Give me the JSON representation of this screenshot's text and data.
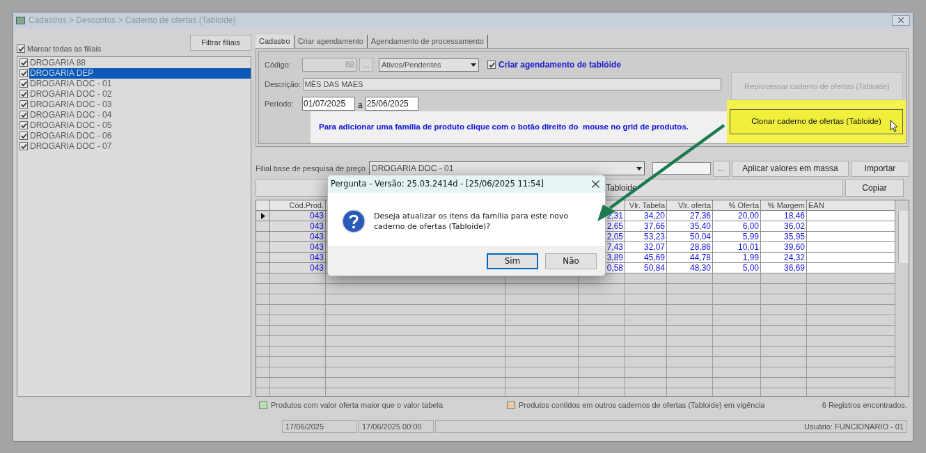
{
  "window": {
    "title": "Cadastros > Descontos > Caderno de ofertas (Tabloide)"
  },
  "branches": {
    "filter_button": "Filtrar filiais",
    "select_all": {
      "label": "Marcar todas as filiais",
      "checked": true
    },
    "items": [
      {
        "label": "DROGARIA 88",
        "checked": true,
        "selected": false
      },
      {
        "label": "DROGARIA DEP",
        "checked": true,
        "selected": true
      },
      {
        "label": "DROGARIA DOC - 01",
        "checked": true,
        "selected": false
      },
      {
        "label": "DROGARIA DOC - 02",
        "checked": true,
        "selected": false
      },
      {
        "label": "DROGARIA DOC - 03",
        "checked": true,
        "selected": false
      },
      {
        "label": "DROGARIA DOC - 04",
        "checked": true,
        "selected": false
      },
      {
        "label": "DROGARIA DOC - 05",
        "checked": true,
        "selected": false
      },
      {
        "label": "DROGARIA DOC - 06",
        "checked": true,
        "selected": false
      },
      {
        "label": "DROGARIA DOC - 07",
        "checked": true,
        "selected": false
      }
    ]
  },
  "tabs": [
    {
      "label": "Cadastro",
      "selected": true
    },
    {
      "label": "Criar agendamento",
      "selected": false
    },
    {
      "label": "Agendamento de processamento",
      "selected": false
    }
  ],
  "form": {
    "code_label": "Código:",
    "code_value": "68",
    "code_button": "...",
    "status_select": "Ativos/Pendentes",
    "schedule_checkbox": {
      "label": "Criar agendamento de tablóide",
      "checked": true
    },
    "description_label": "Descrição:",
    "description_value": "MÊS DAS MAES",
    "period_label": "Período:",
    "period_from": "01/07/2025",
    "period_sep": "a",
    "period_to": "25/06/2025",
    "hint": "Para adicionar uma família de produto clique com o botão direito do  mouse no grid de produtos.",
    "reprocess_button": {
      "label": "Reprocessar caderno de ofertas (Tabloide)",
      "disabled": true
    },
    "clone_button": {
      "label": "Clonar caderno de ofertas (Tabloide)",
      "highlighted": true
    }
  },
  "price_base": {
    "label": "Filial base de pesquisa de preço",
    "value": "DROGARIA DOC - 01",
    "search_button": "...",
    "apply_button": "Aplicar valores em massa",
    "import_button": "Importar",
    "clone_button": "Tabloide",
    "copy_button": "Copiar"
  },
  "grid": {
    "headers": {
      "cod": "Cód.Prod.",
      "vlr_tabela": "Vlr. Tabela",
      "vlr_oferta": "Vlr. oferta",
      "oferta_pct": "% Oferta",
      "margem_pct": "% Margem",
      "ean": "EAN"
    },
    "rows": [
      {
        "current": true,
        "cod": "043",
        "col_5": "2,31",
        "vlr_tabela": "34,20",
        "vlr_oferta": "27,36",
        "oferta_pct": "20,00",
        "margem_pct": "18,46"
      },
      {
        "current": false,
        "cod": "043",
        "col_5": "2,65",
        "vlr_tabela": "37,66",
        "vlr_oferta": "35,40",
        "oferta_pct": "6,00",
        "margem_pct": "36,02"
      },
      {
        "current": false,
        "cod": "043",
        "col_5": "2,05",
        "vlr_tabela": "53,23",
        "vlr_oferta": "50,04",
        "oferta_pct": "5,99",
        "margem_pct": "35,95"
      },
      {
        "current": false,
        "cod": "043",
        "col_5": "7,43",
        "vlr_tabela": "32,07",
        "vlr_oferta": "28,86",
        "oferta_pct": "10,01",
        "margem_pct": "39,60"
      },
      {
        "current": false,
        "cod": "043",
        "col_5": "3,89",
        "vlr_tabela": "45,69",
        "vlr_oferta": "44,78",
        "oferta_pct": "1,99",
        "margem_pct": "24,32"
      },
      {
        "current": false,
        "cod": "043",
        "col_5": "0,58",
        "vlr_tabela": "50,84",
        "vlr_oferta": "48,30",
        "oferta_pct": "5,00",
        "margem_pct": "36,69"
      }
    ]
  },
  "legend": [
    {
      "color": "#b5e3ad",
      "label": "Produtos com valor oferta maior que o valor tabela"
    },
    {
      "color": "#eec9a3",
      "label": "Produtos contidos em outros cadernos de ofertas (Tabloide) em vigência"
    }
  ],
  "record_count": "6 Registros encontrados.",
  "status_bar": {
    "date": "17/06/2025",
    "datetime": "17/06/2025 00:00",
    "user": "Usuário: FUNCIONARIO - 01"
  },
  "dialog": {
    "title": "Pergunta - Versão: 25.03.2414d - [25/06/2025 11:54]",
    "message": "Deseja atualizar os itens da família para este novo caderno de ofertas (Tabloide)?",
    "buttons": [
      "Sim",
      "Não"
    ]
  }
}
